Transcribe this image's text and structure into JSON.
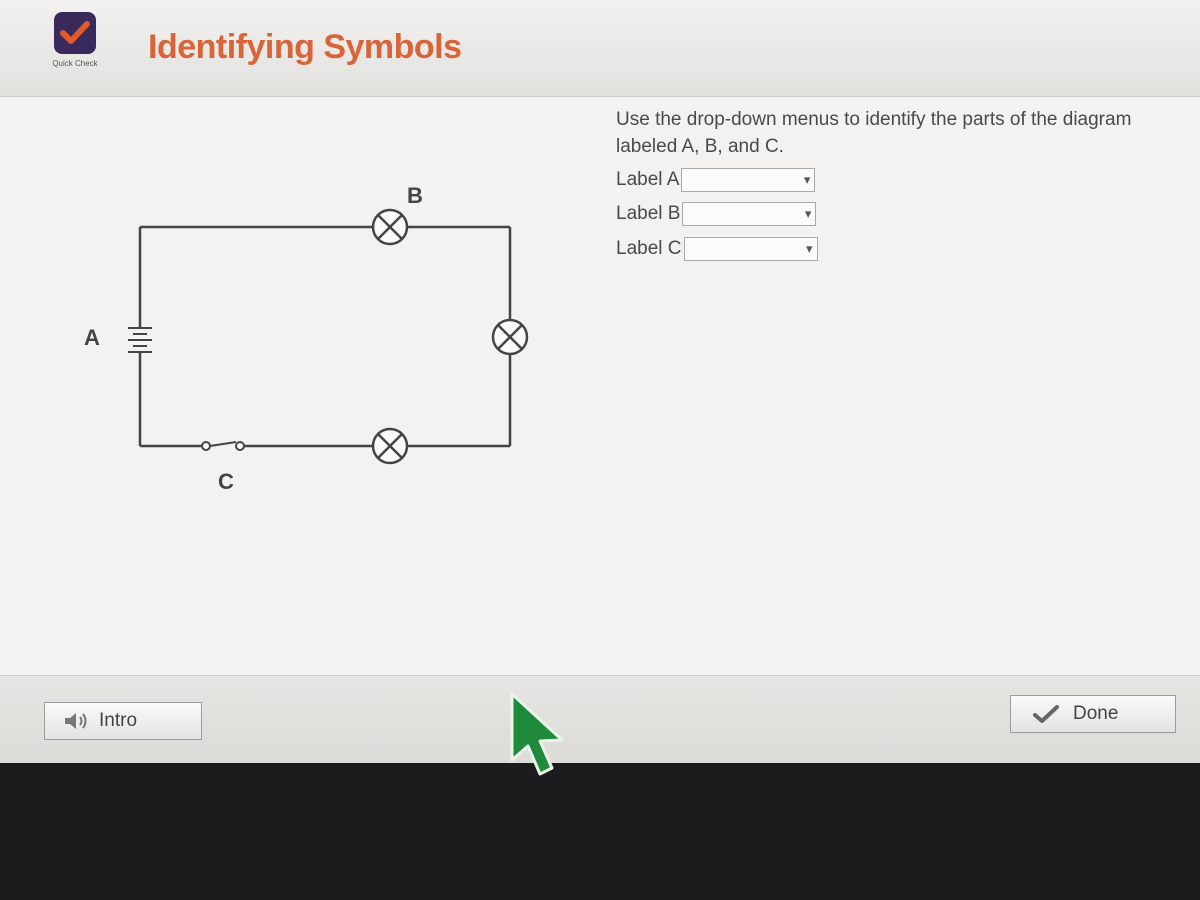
{
  "header": {
    "logo_text": "Quick Check",
    "title": "Identifying Symbols"
  },
  "instructions": "Use the drop-down menus to identify the parts of the diagram labeled A, B, and C.",
  "labels": [
    {
      "text": "Label A",
      "selected": ""
    },
    {
      "text": "Label B",
      "selected": ""
    },
    {
      "text": "Label C",
      "selected": ""
    }
  ],
  "diagram": {
    "label_a": "A",
    "label_b": "B",
    "label_c": "C"
  },
  "footer": {
    "intro_label": "Intro",
    "done_label": "Done"
  },
  "colors": {
    "title": "#d9643a",
    "logo_bg": "#3a2a5c",
    "logo_check": "#e25a2c",
    "cursor": "#1f8a3c"
  },
  "icons": [
    "checkmark-icon",
    "speaker-icon",
    "chevron-down-icon",
    "lamp-icon",
    "battery-icon",
    "switch-icon",
    "mouse-cursor-icon"
  ]
}
